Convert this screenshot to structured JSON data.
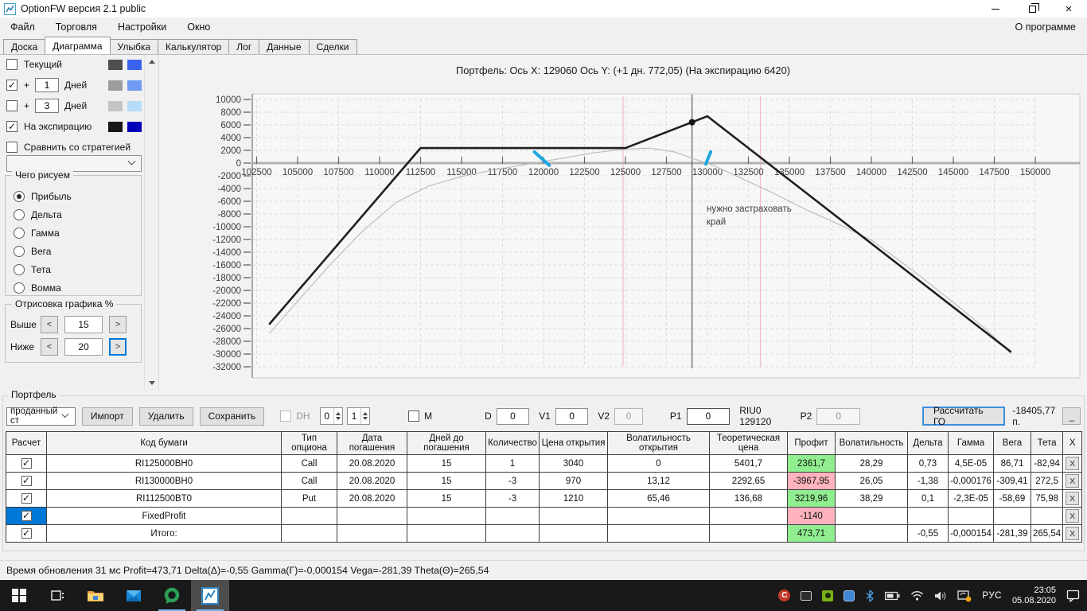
{
  "window": {
    "title": "OptionFW версия 2.1 public"
  },
  "menu": {
    "items": [
      "Файл",
      "Торговля",
      "Настройки",
      "Окно"
    ],
    "right": "О программе"
  },
  "tabs": {
    "items": [
      "Доска",
      "Диаграмма",
      "Улыбка",
      "Калькулятор",
      "Лог",
      "Данные",
      "Сделки"
    ],
    "active": "Диаграмма"
  },
  "sidebar": {
    "current": {
      "label": "Текущий",
      "checked": false,
      "colors": [
        "#4f4f4f",
        "#3a62ef"
      ]
    },
    "plus1": {
      "prefix": "+",
      "value": "1",
      "label": "Дней",
      "checked": true,
      "colors": [
        "#9d9d9d",
        "#6f9cf2"
      ]
    },
    "plus3": {
      "prefix": "+",
      "value": "3",
      "label": "Дней",
      "checked": false,
      "colors": [
        "#c4c4c4",
        "#b6dcf8"
      ]
    },
    "expiry": {
      "label": "На экспирацию",
      "checked": true,
      "colors": [
        "#161616",
        "#0000b8"
      ]
    },
    "compare": {
      "label": "Сравнить со стратегией",
      "checked": false
    },
    "strategy_combo_value": "",
    "draw_group": {
      "title": "Чего рисуем",
      "options": [
        "Прибыль",
        "Дельта",
        "Гамма",
        "Вега",
        "Тета",
        "Вомма"
      ],
      "selected": "Прибыль"
    },
    "range_group": {
      "title": "Отрисовка графика %",
      "above_label": "Выше",
      "above_value": "15",
      "below_label": "Ниже",
      "below_value": "20",
      "less": "<",
      "more": ">"
    }
  },
  "chart_data": {
    "type": "line",
    "title": "Портфель: Ось X: 129060 Ось Y:  (+1 дн. 772,05)  (На экспирацию 6420)",
    "xlim": [
      102500,
      151500
    ],
    "ylim": [
      -32000,
      10000
    ],
    "grid": true,
    "legend_position": "none",
    "x_ticks": [
      102500,
      105000,
      107500,
      110000,
      112500,
      115000,
      117500,
      120000,
      122500,
      125000,
      127500,
      130000,
      132500,
      135000,
      137500,
      140000,
      142500,
      145000,
      147500,
      150000
    ],
    "y_ticks": [
      10000,
      8000,
      6000,
      4000,
      2000,
      0,
      -2000,
      -4000,
      -6000,
      -8000,
      -10000,
      -12000,
      -14000,
      -16000,
      -18000,
      -20000,
      -22000,
      -24000,
      -26000,
      -28000,
      -30000,
      -32000
    ],
    "series": [
      {
        "name": "+1 Дней",
        "color": "#bdbdbd",
        "width": 1.2,
        "points": [
          [
            103296,
            -26700
          ],
          [
            105000,
            -21700
          ],
          [
            107000,
            -15900
          ],
          [
            109000,
            -10600
          ],
          [
            111000,
            -6200
          ],
          [
            113000,
            -3600
          ],
          [
            115000,
            -2100
          ],
          [
            117000,
            -1050
          ],
          [
            119200,
            -100
          ],
          [
            121000,
            700
          ],
          [
            123000,
            1600
          ],
          [
            125000,
            2200
          ],
          [
            126500,
            2350
          ],
          [
            128000,
            1750
          ],
          [
            129060,
            772
          ],
          [
            130400,
            -400
          ],
          [
            132000,
            -2300
          ],
          [
            134000,
            -4700
          ],
          [
            136000,
            -7300
          ],
          [
            138000,
            -9600
          ],
          [
            140000,
            -12100
          ],
          [
            142500,
            -16800
          ],
          [
            145000,
            -21900
          ],
          [
            147000,
            -26100
          ],
          [
            148488,
            -29900
          ]
        ]
      },
      {
        "name": "На экспирацию",
        "color": "#1f1f1f",
        "width": 2.6,
        "points": [
          [
            103296,
            -25252
          ],
          [
            112500,
            2360
          ],
          [
            125000,
            2360
          ],
          [
            130000,
            7360
          ],
          [
            148488,
            -29616
          ]
        ]
      }
    ],
    "marker": {
      "x": 129060,
      "y": 6420
    },
    "crosshair_x": 129060,
    "guide_lines": [
      {
        "x": 124850,
        "color": "#f3bcc6"
      },
      {
        "x": 133230,
        "color": "#f3bcc6"
      }
    ],
    "pen_strokes": [
      {
        "from": [
          119450,
          1750
        ],
        "to": [
          120350,
          -350
        ]
      },
      {
        "from": [
          130200,
          1750
        ],
        "to": [
          129900,
          -150
        ]
      }
    ],
    "annotations": [
      {
        "text": "нужно застраховать",
        "x": 129950,
        "y": -7600
      },
      {
        "text": "край",
        "x": 129950,
        "y": -9700
      }
    ],
    "annotation_color": "#1ba6e0"
  },
  "portfolio": {
    "group_title": "Портфель",
    "strategy_value": "проданный ст",
    "import_btn": "Импорт",
    "delete_btn": "Удалить",
    "save_btn": "Сохранить",
    "dh_label": "DH",
    "dh_checked": false,
    "spin1": "0",
    "spin2": "1",
    "m_label": "M",
    "m_checked": false,
    "d_label": "D",
    "d_value": "0",
    "v1_label": "V1",
    "v1_value": "0",
    "v2_label": "V2",
    "v2_value": "0",
    "p1_label": "P1",
    "p1_value": "0",
    "instrument": "RIU0 129120",
    "p2_label": "P2",
    "p2_value": "0",
    "calc_btn": "Рассчитать ГО",
    "go_value": "-18405,77 п.",
    "collapse_btn": "_"
  },
  "table": {
    "headers": [
      "Расчет",
      "Код бумаги",
      "Тип опциона",
      "Дата погашения",
      "Дней до погашения",
      "Количество",
      "Цена открытия",
      "Волатильность открытия",
      "Теоретическая цена",
      "Профит",
      "Волатильность",
      "Дельта",
      "Гамма",
      "Вега",
      "Тета",
      "X"
    ],
    "delete_label": "X",
    "rows": [
      {
        "checked": true,
        "code": "RI125000BH0",
        "type": "Call",
        "date": "20.08.2020",
        "days": "15",
        "qty": "1",
        "open_price": "3040",
        "open_vol": "0",
        "theo": "5401,7",
        "profit": "2361,7",
        "profit_color": "pos",
        "vol": "28,29",
        "delta": "0,73",
        "gamma": "4,5E-05",
        "vega": "86,71",
        "theta": "-82,94"
      },
      {
        "checked": true,
        "code": "RI130000BH0",
        "type": "Call",
        "date": "20.08.2020",
        "days": "15",
        "qty": "-3",
        "open_price": "970",
        "open_vol": "13,12",
        "theo": "2292,65",
        "profit": "-3967,95",
        "profit_color": "neg",
        "vol": "26,05",
        "delta": "-1,38",
        "gamma": "-0,000176",
        "vega": "-309,41",
        "theta": "272,5"
      },
      {
        "checked": true,
        "code": "RI112500BT0",
        "type": "Put",
        "date": "20.08.2020",
        "days": "15",
        "qty": "-3",
        "open_price": "1210",
        "open_vol": "65,46",
        "theo": "136,68",
        "profit": "3219,96",
        "profit_color": "pos",
        "vol": "38,29",
        "delta": "0,1",
        "gamma": "-2,3E-05",
        "vega": "-58,69",
        "theta": "75,98"
      },
      {
        "checked": true,
        "selected": true,
        "code": "FixedProfit",
        "profit": "-1140",
        "profit_color": "neg"
      },
      {
        "checked": true,
        "code": "Итого:",
        "profit": "473,71",
        "profit_color": "pos",
        "delta": "-0,55",
        "gamma": "-0,000154",
        "vega": "-281,39",
        "theta": "265,54"
      }
    ]
  },
  "colors": {
    "profit_pos": "#90ee90",
    "profit_neg": "#ffb3bd",
    "selection": "#0078d7",
    "accent": "#0078d7"
  },
  "statusbar": {
    "text": "Время обновления 31 мс  Profit=473,71 Delta(Δ)=-0,55 Gamma(Γ)=-0,000154 Vega=-281,39 Theta(Θ)=265,54"
  },
  "taskbar": {
    "lang": "РУС",
    "time": "23:05",
    "date": "05.08.2020"
  }
}
